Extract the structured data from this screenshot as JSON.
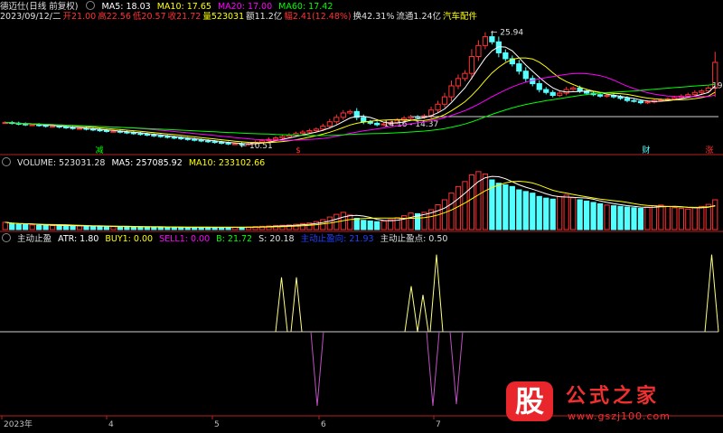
{
  "colors": {
    "up": "#ff3232",
    "down": "#54ffff",
    "ma5": "#ffffff",
    "ma10": "#ffff00",
    "ma20": "#ff00ff",
    "ma60": "#00ff00",
    "axis": "#b22222",
    "grid": "#5a0000",
    "label": "#c0c0c0",
    "indicator_line": "#ffff80",
    "indicator_neg": "#c050c0",
    "baseline": "#d0d0d0"
  },
  "price_panel": {
    "header": {
      "date": "2023/09/12/二",
      "open_label": "开",
      "open": "21.00",
      "high_label": "高",
      "high": "22.56",
      "low_label": "低",
      "low": "20.57",
      "close_label": "收",
      "close": "21.72",
      "vol_label": "量",
      "vol": "523031",
      "amt_label": "额",
      "amt": "11.2亿",
      "chg_label": "幅",
      "chg": "2.41(12.48%)",
      "turnover_label": "换",
      "turnover": "42.31%",
      "float_label": "流通",
      "float": "1.24亿",
      "sector": "汽车配件"
    },
    "title": "德迈仕(日线 前复权)",
    "ma_labels": {
      "ma5": "MA5: 18.03",
      "ma10": "MA10: 17.65",
      "ma20": "MA20: 17.00",
      "ma60": "MA60: 17.42"
    },
    "annotations": {
      "high": "25.94",
      "low": "10.51",
      "range": "14.16 - 14.37",
      "right_edge": "19"
    },
    "event_marks": [
      {
        "text": "减",
        "color": "#00ff00"
      },
      {
        "text": "$",
        "color": "#ff3232"
      },
      {
        "text": "财",
        "color": "#54ffff"
      },
      {
        "text": "涨",
        "color": "#ff3232"
      }
    ]
  },
  "volume_panel": {
    "labels": {
      "vol": "VOLUME: 523031.28",
      "ma5": "MA5: 257085.92",
      "ma10": "MA10: 233102.66"
    }
  },
  "indicator_panel": {
    "labels": {
      "name": "主动止盈",
      "atr": "ATR: 1.80",
      "buy1": "BUY1: 0.00",
      "sell1": "SELL1: 0.00",
      "b": "B: 21.72",
      "s": "S: 20.18",
      "dir": "主动止盈向: 21.93",
      "point": "主动止盈点: 0.50"
    }
  },
  "x_axis": {
    "ticks": [
      "2023年",
      "4",
      "5",
      "6",
      "7"
    ]
  },
  "watermark": {
    "logo": "股",
    "title": "公式之家",
    "url": "www.gszj100.com"
  },
  "chart_data": {
    "type": "candlestick",
    "description_fields": [
      "close",
      "ma5",
      "ma10",
      "ma20",
      "ma60",
      "volume",
      "indicator"
    ],
    "x": [
      "2023年",
      "4",
      "5",
      "6",
      "7"
    ],
    "price": {
      "high": 25.94,
      "low": 10.51,
      "last_close": 21.72,
      "close_series": [
        13.5,
        13.4,
        13.3,
        13.2,
        13.2,
        13.1,
        13.0,
        13.0,
        12.9,
        12.8,
        12.7,
        12.7,
        12.6,
        12.5,
        12.4,
        12.3,
        12.3,
        12.2,
        12.1,
        12.0,
        11.9,
        11.8,
        11.7,
        11.6,
        11.5,
        11.4,
        11.3,
        11.2,
        11.1,
        11.0,
        10.9,
        10.8,
        10.7,
        10.6,
        10.6,
        10.5,
        10.6,
        10.8,
        11.0,
        11.2,
        11.4,
        11.6,
        11.8,
        12.0,
        12.2,
        12.4,
        12.6,
        13.0,
        13.6,
        14.2,
        14.8,
        15.0,
        14.2,
        13.6,
        13.4,
        13.2,
        13.3,
        13.5,
        13.8,
        14.1,
        14.3,
        14.2,
        14.4,
        15.2,
        16.0,
        17.0,
        18.5,
        19.5,
        20.2,
        22.5,
        24.0,
        25.2,
        24.5,
        23.0,
        22.2,
        21.5,
        20.5,
        19.5,
        18.8,
        18.0,
        17.6,
        17.2,
        17.5,
        18.0,
        18.2,
        17.8,
        17.5,
        17.3,
        17.1,
        17.2,
        17.0,
        16.8,
        16.5,
        16.4,
        16.2,
        16.3,
        16.5,
        16.6,
        16.7,
        16.9,
        17.1,
        17.3,
        17.6,
        17.8,
        18.2,
        21.7
      ],
      "ma60_end": 17.42
    },
    "volume": {
      "last": 523031.28,
      "ma5": 257085.92,
      "ma10": 233102.66,
      "series": [
        22,
        18,
        16,
        15,
        14,
        13,
        13,
        12,
        12,
        12,
        11,
        11,
        10,
        10,
        10,
        9,
        9,
        9,
        9,
        8,
        8,
        8,
        8,
        8,
        7,
        7,
        7,
        7,
        7,
        7,
        7,
        7,
        7,
        7,
        7,
        7,
        8,
        9,
        10,
        11,
        12,
        13,
        14,
        16,
        18,
        20,
        24,
        30,
        38,
        46,
        52,
        44,
        34,
        28,
        26,
        24,
        26,
        30,
        36,
        42,
        50,
        48,
        52,
        60,
        75,
        90,
        110,
        130,
        145,
        165,
        175,
        168,
        150,
        140,
        135,
        130,
        120,
        115,
        110,
        100,
        95,
        92,
        100,
        104,
        96,
        90,
        86,
        82,
        78,
        74,
        72,
        70,
        68,
        66,
        64,
        68,
        72,
        74,
        70,
        66,
        64,
        62,
        66,
        70,
        76,
        90
      ]
    },
    "indicator": {
      "name": "主动止盈",
      "spikes_up": [
        0.62,
        0.62,
        0.52,
        0.42,
        0.88,
        0.88,
        0.92,
        0.8,
        0.9
      ],
      "spikes_down": [
        0.9,
        0.9,
        0.88,
        0.85
      ],
      "baseline_label": "0.50"
    }
  }
}
